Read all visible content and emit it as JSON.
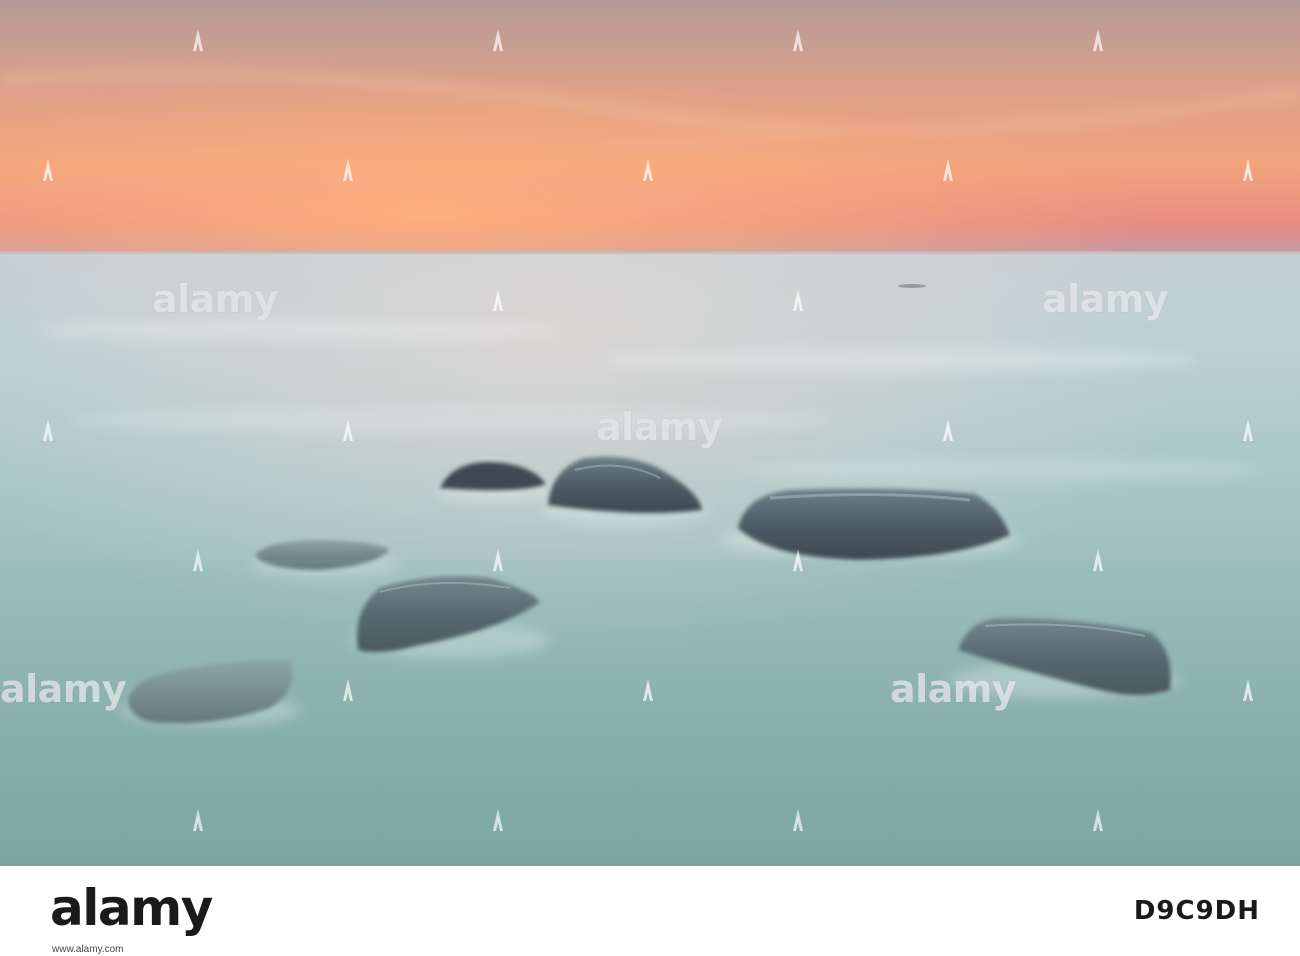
{
  "image": {
    "description_colors": {
      "sky_top": "#c99a8a",
      "sky_glow": "#f2a07a",
      "horizon_pink": "#e88b86",
      "sea_far": "#b7cdd0",
      "sea_near": "#7fa8a6",
      "rock_dark": "#4b5560"
    }
  },
  "watermark": {
    "word": "alamy",
    "mark_icon": "alamy-a-icon"
  },
  "footer": {
    "logo": "alamy",
    "url": "www.alamy.com",
    "image_id": "D9C9DH"
  }
}
